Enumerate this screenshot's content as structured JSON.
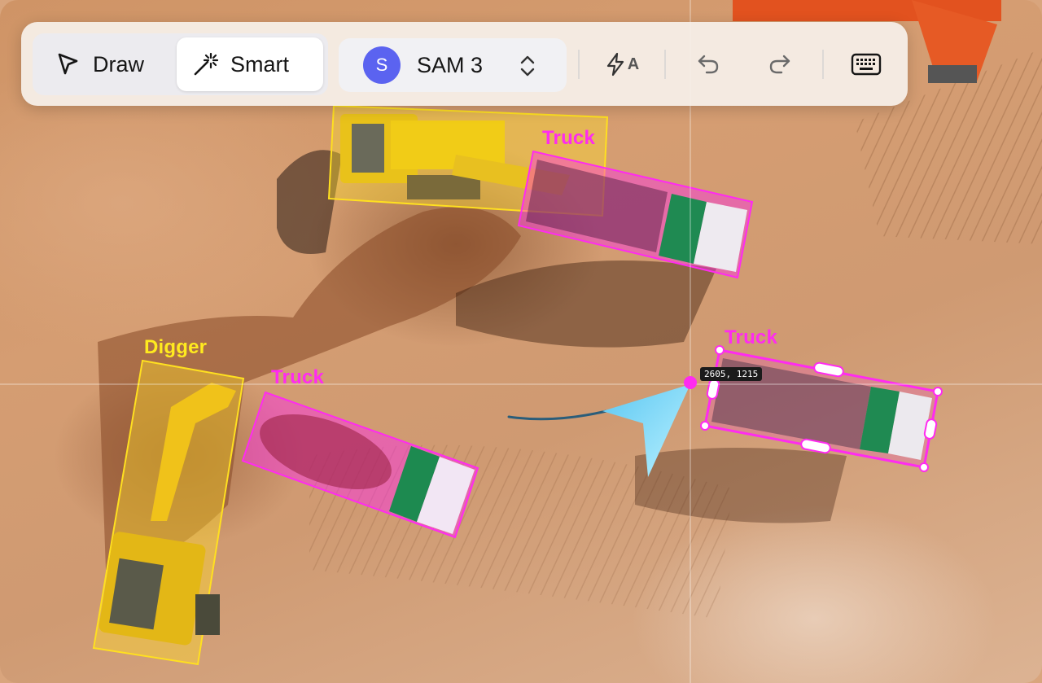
{
  "toolbar": {
    "draw_label": "Draw",
    "smart_label": "Smart",
    "model": {
      "avatar_letter": "S",
      "name": "SAM 3",
      "avatar_color": "#5b63f0"
    },
    "auto_label": "A",
    "icons": [
      "cursor-arrow-icon",
      "magic-wand-icon",
      "chevron-updown-icon",
      "lightning-icon",
      "undo-icon",
      "redo-icon",
      "keyboard-icon"
    ]
  },
  "annotations": [
    {
      "label": "Truck",
      "color": "#ff2bf0"
    },
    {
      "label": "Truck",
      "color": "#ff2bf0"
    },
    {
      "label": "Truck",
      "color": "#ff2bf0"
    },
    {
      "label": "Digger",
      "color": "#ffea1f"
    }
  ],
  "cursor": {
    "coordinates": "2605, 1215"
  },
  "colors": {
    "truck": "#ff2bf0",
    "digger": "#ffea1f",
    "accent": "#5b63f0"
  }
}
